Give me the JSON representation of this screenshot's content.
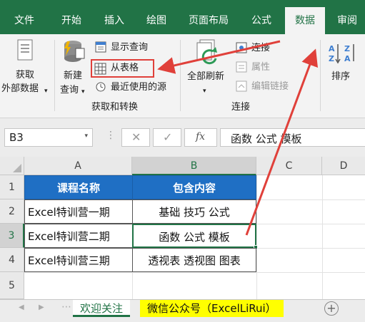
{
  "tabs": [
    {
      "label": "文件"
    },
    {
      "label": "开始"
    },
    {
      "label": "插入"
    },
    {
      "label": "绘图"
    },
    {
      "label": "页面布局"
    },
    {
      "label": "公式"
    },
    {
      "label": "数据",
      "active": true
    },
    {
      "label": "审阅"
    }
  ],
  "ribbon": {
    "get_data_label_1": "获取",
    "get_data_label_2": "外部数据",
    "new_query_label_1": "新建",
    "new_query_label_2": "查询",
    "show_queries": "显示查询",
    "from_table": "从表格",
    "recent_sources": "最近使用的源",
    "group_get_transform": "获取和转换",
    "refresh_all_1": "全部刷新",
    "connections": "连接",
    "properties": "属性",
    "edit_links": "编辑链接",
    "group_connections": "连接",
    "sort": "排序"
  },
  "formula_bar": {
    "name_box": "B3",
    "fx": "fx",
    "content": "函数 公式 模板"
  },
  "sheet": {
    "columns": [
      "A",
      "B",
      "C",
      "D"
    ],
    "rows": [
      "1",
      "2",
      "3",
      "4",
      "5"
    ],
    "header_row": [
      "课程名称",
      "包含内容"
    ],
    "data_rows": [
      [
        "Excel特训营一期",
        "基础 技巧 公式"
      ],
      [
        "Excel特训营二期",
        "函数 公式 模板"
      ],
      [
        "Excel特训营三期",
        "透视表 透视图 图表"
      ]
    ]
  },
  "sheet_tabs": [
    {
      "label": "欢迎关注"
    },
    {
      "label": "微信公众号（ExcelLiRui）"
    }
  ],
  "colors": {
    "excel_green": "#217346",
    "header_blue": "#1f6fc4",
    "annotation_red": "#e0403a",
    "highlight_yellow": "#ffff00"
  }
}
